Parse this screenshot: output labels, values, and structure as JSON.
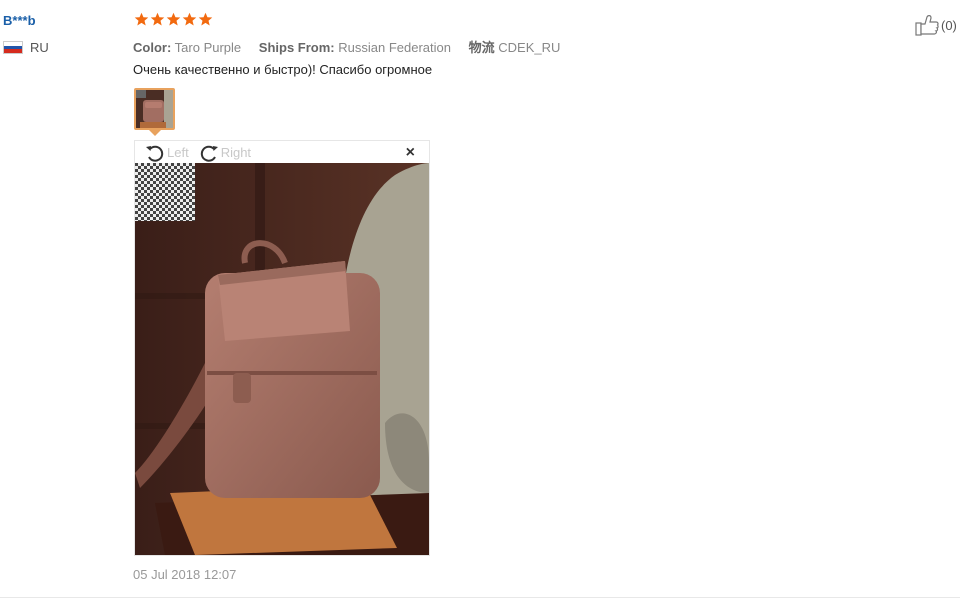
{
  "review": {
    "user_name": "B***b",
    "country_code": "RU",
    "rating": 5,
    "props": {
      "color_label": "Color:",
      "color_value": "Taro Purple",
      "ships_label": "Ships From:",
      "ships_value": "Russian Federation",
      "logistics_label": "物流",
      "logistics_value": "CDEK_RU"
    },
    "text": "Очень качественно и быстро)! Спасибо огромное",
    "date": "05 Jul 2018 12:07",
    "likes": "(0)"
  },
  "viewer": {
    "rotate_left_label": "Left",
    "rotate_right_label": "Right",
    "close_glyph": "×"
  },
  "colors": {
    "username": "#1a5fa8",
    "star": "#f26a10",
    "thumb_border": "#e8a25e",
    "meta_text": "#888888"
  },
  "icons": [
    "star-icon",
    "flag-icon",
    "rotate-left-icon",
    "rotate-right-icon",
    "close-icon",
    "thumbs-up-icon"
  ]
}
